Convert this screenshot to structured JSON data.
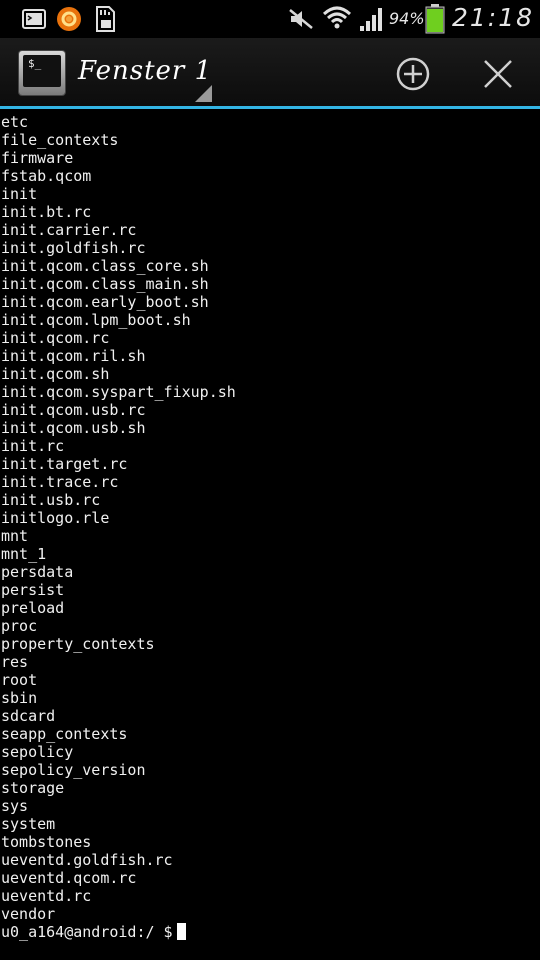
{
  "status_bar": {
    "battery_percent": "94%",
    "battery_level": 0.94,
    "time": "21:18",
    "icons": [
      "terminal-icon",
      "firefox-icon",
      "sd-card-icon",
      "mute-icon",
      "wifi-icon",
      "signal-icon",
      "battery-icon"
    ]
  },
  "action_bar": {
    "title": "Fenster 1",
    "icons": [
      "terminal-app-icon",
      "add-icon",
      "close-icon"
    ],
    "accent_color": "#33b5e5"
  },
  "terminal": {
    "lines": [
      "etc",
      "file_contexts",
      "firmware",
      "fstab.qcom",
      "init",
      "init.bt.rc",
      "init.carrier.rc",
      "init.goldfish.rc",
      "init.qcom.class_core.sh",
      "init.qcom.class_main.sh",
      "init.qcom.early_boot.sh",
      "init.qcom.lpm_boot.sh",
      "init.qcom.rc",
      "init.qcom.ril.sh",
      "init.qcom.sh",
      "init.qcom.syspart_fixup.sh",
      "init.qcom.usb.rc",
      "init.qcom.usb.sh",
      "init.rc",
      "init.target.rc",
      "init.trace.rc",
      "init.usb.rc",
      "initlogo.rle",
      "mnt",
      "mnt_1",
      "persdata",
      "persist",
      "preload",
      "proc",
      "property_contexts",
      "res",
      "root",
      "sbin",
      "sdcard",
      "seapp_contexts",
      "sepolicy",
      "sepolicy_version",
      "storage",
      "sys",
      "system",
      "tombstones",
      "ueventd.goldfish.rc",
      "ueventd.qcom.rc",
      "ueventd.rc",
      "vendor"
    ],
    "prompt": "u0_a164@android:/ $"
  }
}
